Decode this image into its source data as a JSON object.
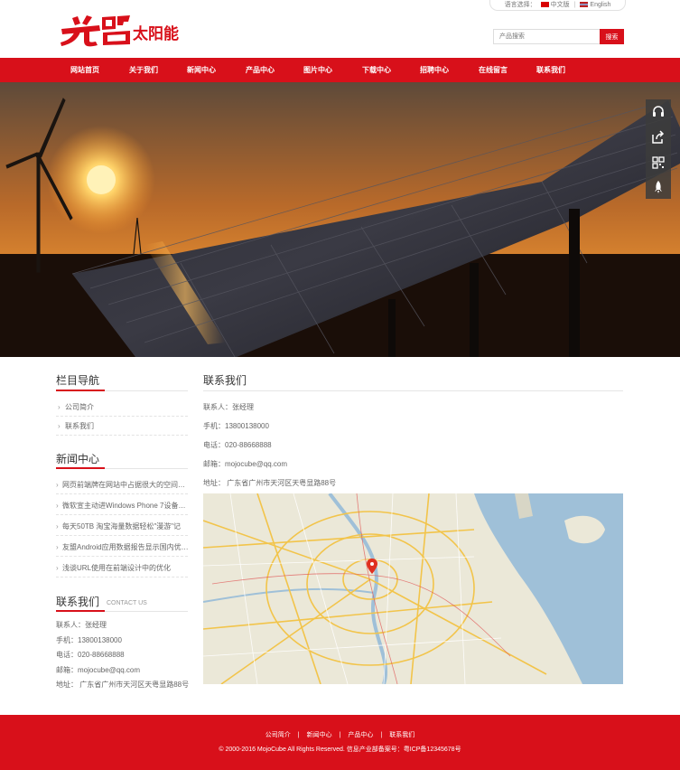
{
  "header": {
    "lang_label": "语言选择：",
    "lang_cn": "中文版",
    "lang_en": "English",
    "lang_sep": "|",
    "logo_text": "光照太阳能",
    "search_placeholder": "产品搜索",
    "search_button": "搜索"
  },
  "nav": {
    "items": [
      "网站首页",
      "关于我们",
      "新闻中心",
      "产品中心",
      "图片中心",
      "下载中心",
      "招聘中心",
      "在线留言",
      "联系我们"
    ]
  },
  "banner": {
    "active_slide": 1,
    "slide_count": 2
  },
  "float_tools": [
    "headset-icon",
    "share-icon",
    "qrcode-icon",
    "rocket-icon"
  ],
  "sidebar": {
    "nav_title": "栏目导航",
    "nav_items": [
      "公司简介",
      "联系我们"
    ],
    "news_title": "新闻中心",
    "news_items": [
      "网页前端牌在网站中占据很大的空间…",
      "微软宣主动进Windows Phone 7设备…",
      "每天50TB 淘宝海量数据轻松\"漫游\"记",
      "友盟Android应用数据报告显示国内优…",
      "浅谈URL使用在前端设计中的优化"
    ],
    "contact_title": "联系我们",
    "contact_subtitle": "CONTACT US",
    "contact_lines": [
      "联系人：张经理",
      "手机：13800138000",
      "电话：020-88668888",
      "邮箱：mojocube@qq.com",
      "地址： 广东省广州市天河区天粤显路88号"
    ]
  },
  "main": {
    "title": "联系我们",
    "lines": [
      "联系人：张经理",
      "手机：13800138000",
      "电话：020-88668888",
      "邮箱：mojocube@qq.com",
      "地址： 广东省广州市天河区天粤显路88号"
    ]
  },
  "footer": {
    "links": [
      "公司简介",
      "新闻中心",
      "产品中心",
      "联系我们"
    ],
    "link_sep": "|",
    "copyright": "© 2000-2016 MojoCube All Rights Reserved. 信息产业部备案号：粤ICP备12345678号"
  },
  "colors": {
    "brand_red": "#d8101a"
  }
}
